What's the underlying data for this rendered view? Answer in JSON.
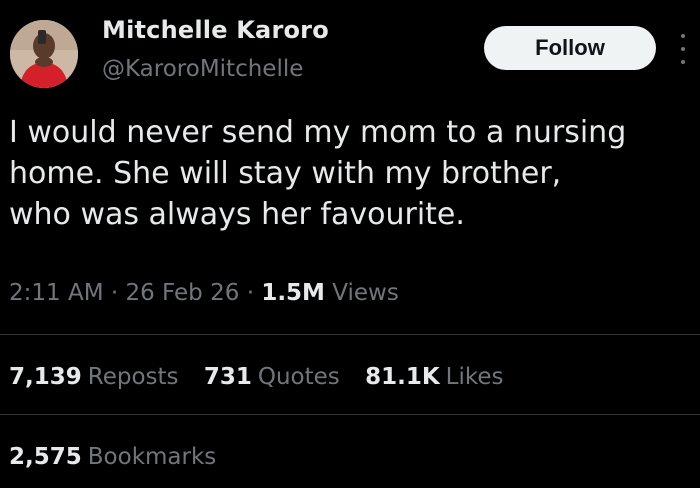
{
  "author": {
    "name": "Mitchelle Karoro",
    "handle": "@KaroroMitchelle"
  },
  "actions": {
    "follow_label": "Follow",
    "more_icon": "more-vertical-icon"
  },
  "tweet": {
    "text": "I would never send my mom to a nursing\nhome. She will stay with my brother,\nwho was always her favourite."
  },
  "meta": {
    "time": "2:11 AM",
    "separator1": "·",
    "date": "26 Feb 26",
    "separator2": "·",
    "views_count": "1.5M",
    "views_label": "Views"
  },
  "stats": {
    "reposts_count": "7,139",
    "reposts_label": "Reposts",
    "quotes_count": "731",
    "quotes_label": "Quotes",
    "likes_count": "81.1K",
    "likes_label": "Likes",
    "bookmarks_count": "2,575",
    "bookmarks_label": "Bookmarks"
  },
  "colors": {
    "background": "#000000",
    "primary_text": "#e7e9ea",
    "secondary_text": "#71767b",
    "divider": "#2f3336",
    "follow_button_bg": "#eff3f4"
  }
}
